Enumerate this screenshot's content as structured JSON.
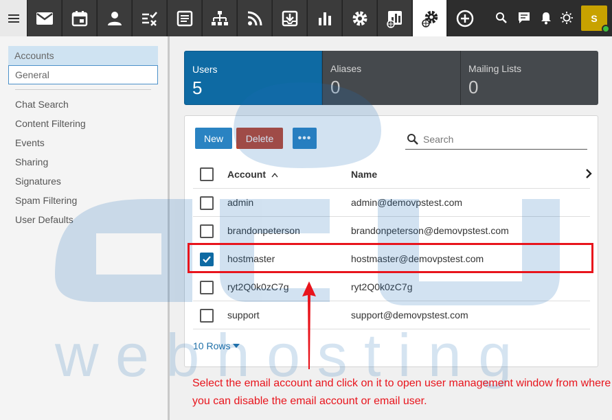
{
  "sidebar": {
    "items": [
      {
        "label": "Accounts"
      },
      {
        "label": "General"
      },
      {
        "label": "Chat Search"
      },
      {
        "label": "Content Filtering"
      },
      {
        "label": "Events"
      },
      {
        "label": "Sharing"
      },
      {
        "label": "Signatures"
      },
      {
        "label": "Spam Filtering"
      },
      {
        "label": "User Defaults"
      }
    ]
  },
  "stats": [
    {
      "label": "Users",
      "value": "5"
    },
    {
      "label": "Aliases",
      "value": "0"
    },
    {
      "label": "Mailing Lists",
      "value": "0"
    }
  ],
  "toolbar": {
    "new_label": "New",
    "delete_label": "Delete",
    "more_label": "•••",
    "search_placeholder": "Search"
  },
  "table": {
    "columns": [
      "Account",
      "Name"
    ],
    "rows": [
      {
        "account": "admin",
        "name": "admin@demovpstest.com",
        "checked": false
      },
      {
        "account": "brandonpeterson",
        "name": "brandonpeterson@demovpstest.com",
        "checked": false
      },
      {
        "account": "hostmaster",
        "name": "hostmaster@demovpstest.com",
        "checked": true
      },
      {
        "account": "ryt2Q0k0zC7g",
        "name": "ryt2Q0k0zC7g",
        "checked": false
      },
      {
        "account": "support",
        "name": "support@demovpstest.com",
        "checked": false
      }
    ],
    "rows_label": "10 Rows"
  },
  "user": {
    "initial": "S"
  },
  "annotation": {
    "text": "Select the email account and click on it to open user management window from where you can disable the email account or email user."
  },
  "watermark": {
    "logo": "acu",
    "tagline": "w e b   h o s t i n g"
  },
  "colors": {
    "accent": "#0e6aa3",
    "danger": "#c0432b",
    "annotation": "#e8141c",
    "toolbar": "#3b3b3b",
    "avatar": "#c8a200"
  },
  "icons": {
    "top": [
      "menu-icon",
      "mail-icon",
      "calendar-icon",
      "contacts-icon",
      "tasks-icon",
      "notes-icon",
      "sitemap-icon",
      "rss-icon",
      "archive-icon",
      "reports-icon",
      "settings-icon",
      "domain-reports-icon",
      "domain-settings-icon",
      "add-icon",
      "search-icon",
      "chat-icon",
      "bell-icon",
      "sun-icon"
    ]
  }
}
